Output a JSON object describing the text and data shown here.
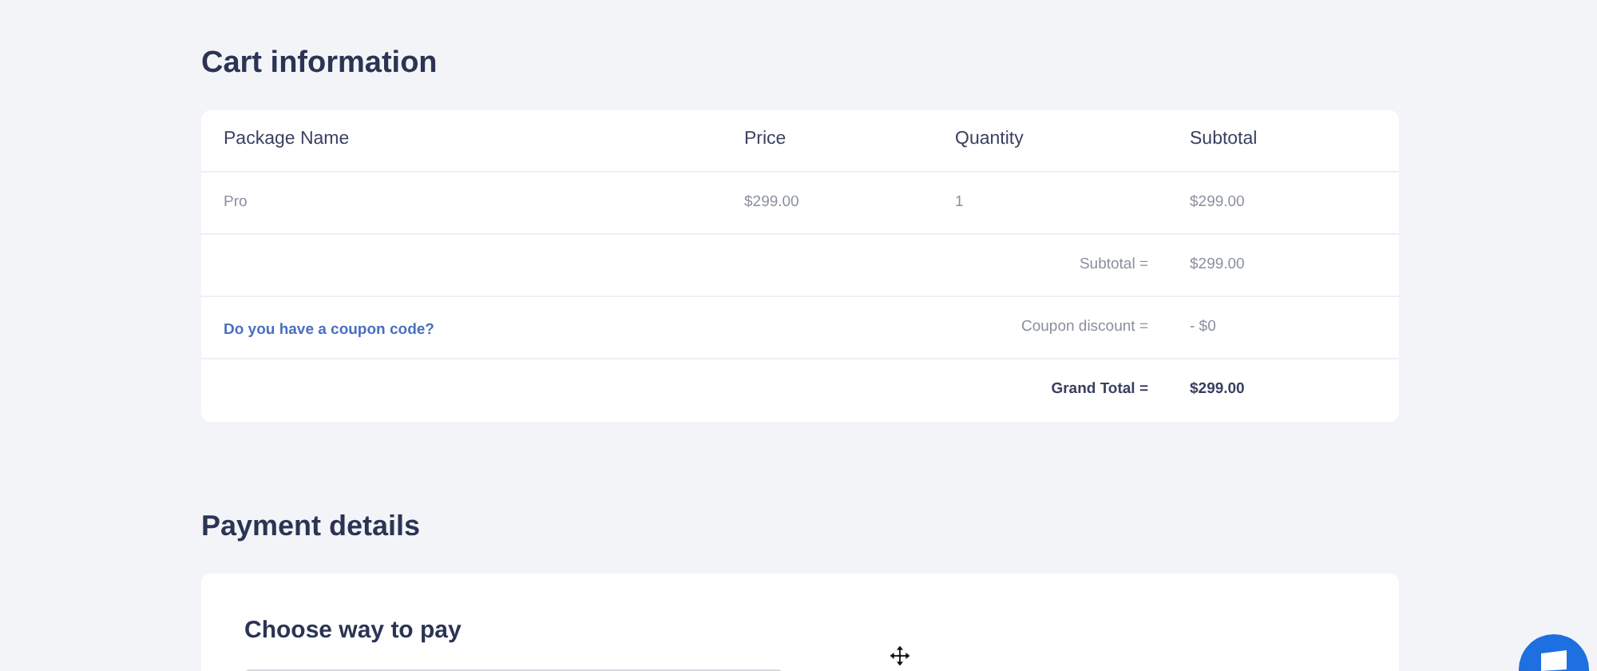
{
  "cart": {
    "title": "Cart information",
    "columns": [
      "Package Name",
      "Price",
      "Quantity",
      "Subtotal"
    ],
    "rows": [
      [
        "Pro",
        "$299.00",
        "1",
        "$299.00"
      ]
    ],
    "summary": [
      {
        "label": "Subtotal =",
        "value": "$299.00",
        "bold": false
      },
      {
        "link": "Do you have a coupon code?",
        "label": "Coupon discount =",
        "value": "- $0",
        "bold": false
      },
      {
        "label": "Grand Total =",
        "value": "$299.00",
        "bold": true
      }
    ]
  },
  "payment": {
    "title": "Payment details",
    "subtitle": "Choose way to pay"
  }
}
